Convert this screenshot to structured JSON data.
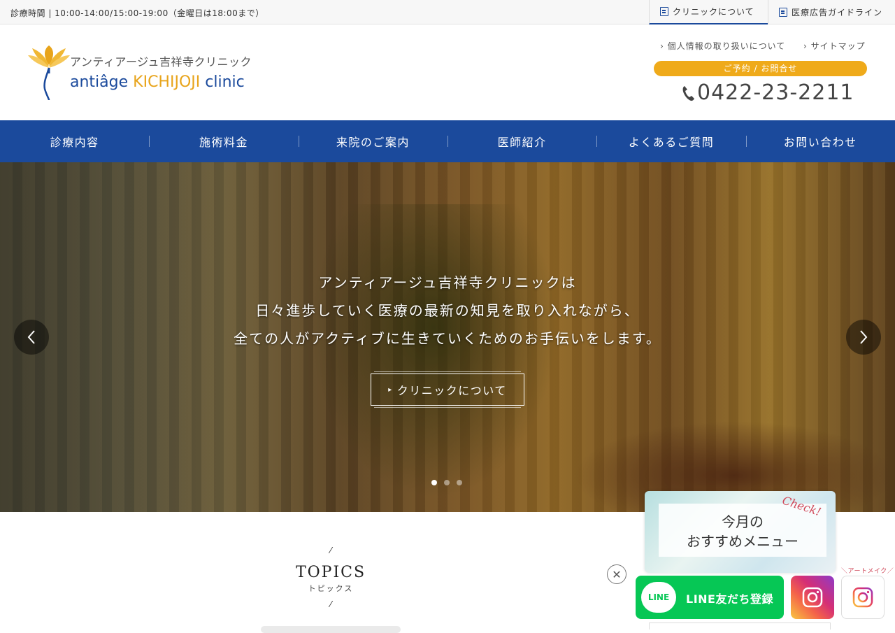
{
  "topbar": {
    "hours": "診療時間 | 10:00-14:00/15:00-19:00（金曜日は18:00まで）",
    "links": [
      {
        "label": "クリニックについて",
        "icon": "building-icon"
      },
      {
        "label": "医療広告ガイドライン",
        "icon": "document-icon"
      }
    ]
  },
  "header": {
    "logo_jp": "アンティアージュ吉祥寺クリニック",
    "logo_en_a": "antiâge",
    "logo_en_b": "KICHIJOJI",
    "logo_en_c": "clinic",
    "sublinks": [
      "個人情報の取り扱いについて",
      "サイトマップ"
    ],
    "reserve_label": "ご予約 / お問合せ",
    "phone": "0422-23-2211"
  },
  "nav": {
    "items": [
      "診療内容",
      "施術料金",
      "来院のご案内",
      "医師紹介",
      "よくあるご質問",
      "お問い合わせ"
    ]
  },
  "hero": {
    "lines": [
      "アンティアージュ吉祥寺クリニックは",
      "日々進歩していく医療の最新の知見を取り入れながら、",
      "全ての人がアクティブに生きていくためのお手伝いをします。"
    ],
    "button_label": "クリニックについて",
    "slide_count": 3,
    "active_slide": 1
  },
  "topics": {
    "title_en": "TOPICS",
    "title_jp": "トピックス"
  },
  "floating": {
    "promo_line1": "今月の",
    "promo_line2": "おすすめメニュー",
    "promo_badge": "Check!",
    "line_icon_text": "LINE",
    "line_label": "LINE友だち登録",
    "artmake_label": "＼アートメイク／"
  },
  "colors": {
    "brand_blue": "#1b4a9c",
    "brand_gold": "#efaa1a",
    "line_green": "#06c755"
  }
}
